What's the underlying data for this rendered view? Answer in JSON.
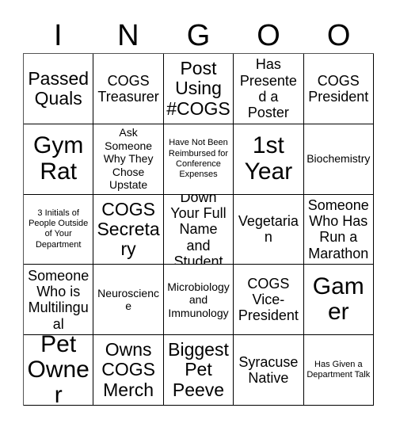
{
  "card": {
    "header_letters": [
      "I",
      "N",
      "G",
      "O",
      "O"
    ],
    "grid": {
      "rows": 5,
      "columns": 5,
      "cells": [
        {
          "text": "Passed Quals",
          "size": "lg"
        },
        {
          "text": "COGS Treasurer",
          "size": "md"
        },
        {
          "text": "Post Using #COGS",
          "size": "lg"
        },
        {
          "text": "Has Presented a Poster",
          "size": "md"
        },
        {
          "text": "COGS President",
          "size": "md"
        },
        {
          "text": "Gym Rat",
          "size": "xl"
        },
        {
          "text": "Ask Someone Why They Chose Upstate",
          "size": "sm"
        },
        {
          "text": "Have Not Been Reimbursed for Conference Expenses",
          "size": "xs"
        },
        {
          "text": "1st Year",
          "size": "xl"
        },
        {
          "text": "Biochemistry",
          "size": "sm"
        },
        {
          "text": "3 Initials of People Outside of Your Department",
          "size": "xs"
        },
        {
          "text": "COGS Secretary",
          "size": "lg"
        },
        {
          "text": "Write Down Your Full Name and Student ID",
          "size": "md"
        },
        {
          "text": "Vegetarian",
          "size": "md"
        },
        {
          "text": "Someone Who Has Run a Marathon",
          "size": "md"
        },
        {
          "text": "Someone Who is Multilingual",
          "size": "md"
        },
        {
          "text": "Neuroscience",
          "size": "sm"
        },
        {
          "text": "Microbiology and Immunology",
          "size": "sm"
        },
        {
          "text": "COGS Vice-President",
          "size": "md"
        },
        {
          "text": "Gamer",
          "size": "xl"
        },
        {
          "text": "Pet Owner",
          "size": "xl"
        },
        {
          "text": "Owns COGS Merch",
          "size": "lg"
        },
        {
          "text": "Biggest Pet Peeve",
          "size": "lg"
        },
        {
          "text": "Syracuse Native",
          "size": "md"
        },
        {
          "text": "Has Given a Department Talk",
          "size": "xs"
        }
      ]
    },
    "colors": {
      "background": "#ffffff",
      "text": "#000000",
      "grid_line": "#000000"
    }
  }
}
